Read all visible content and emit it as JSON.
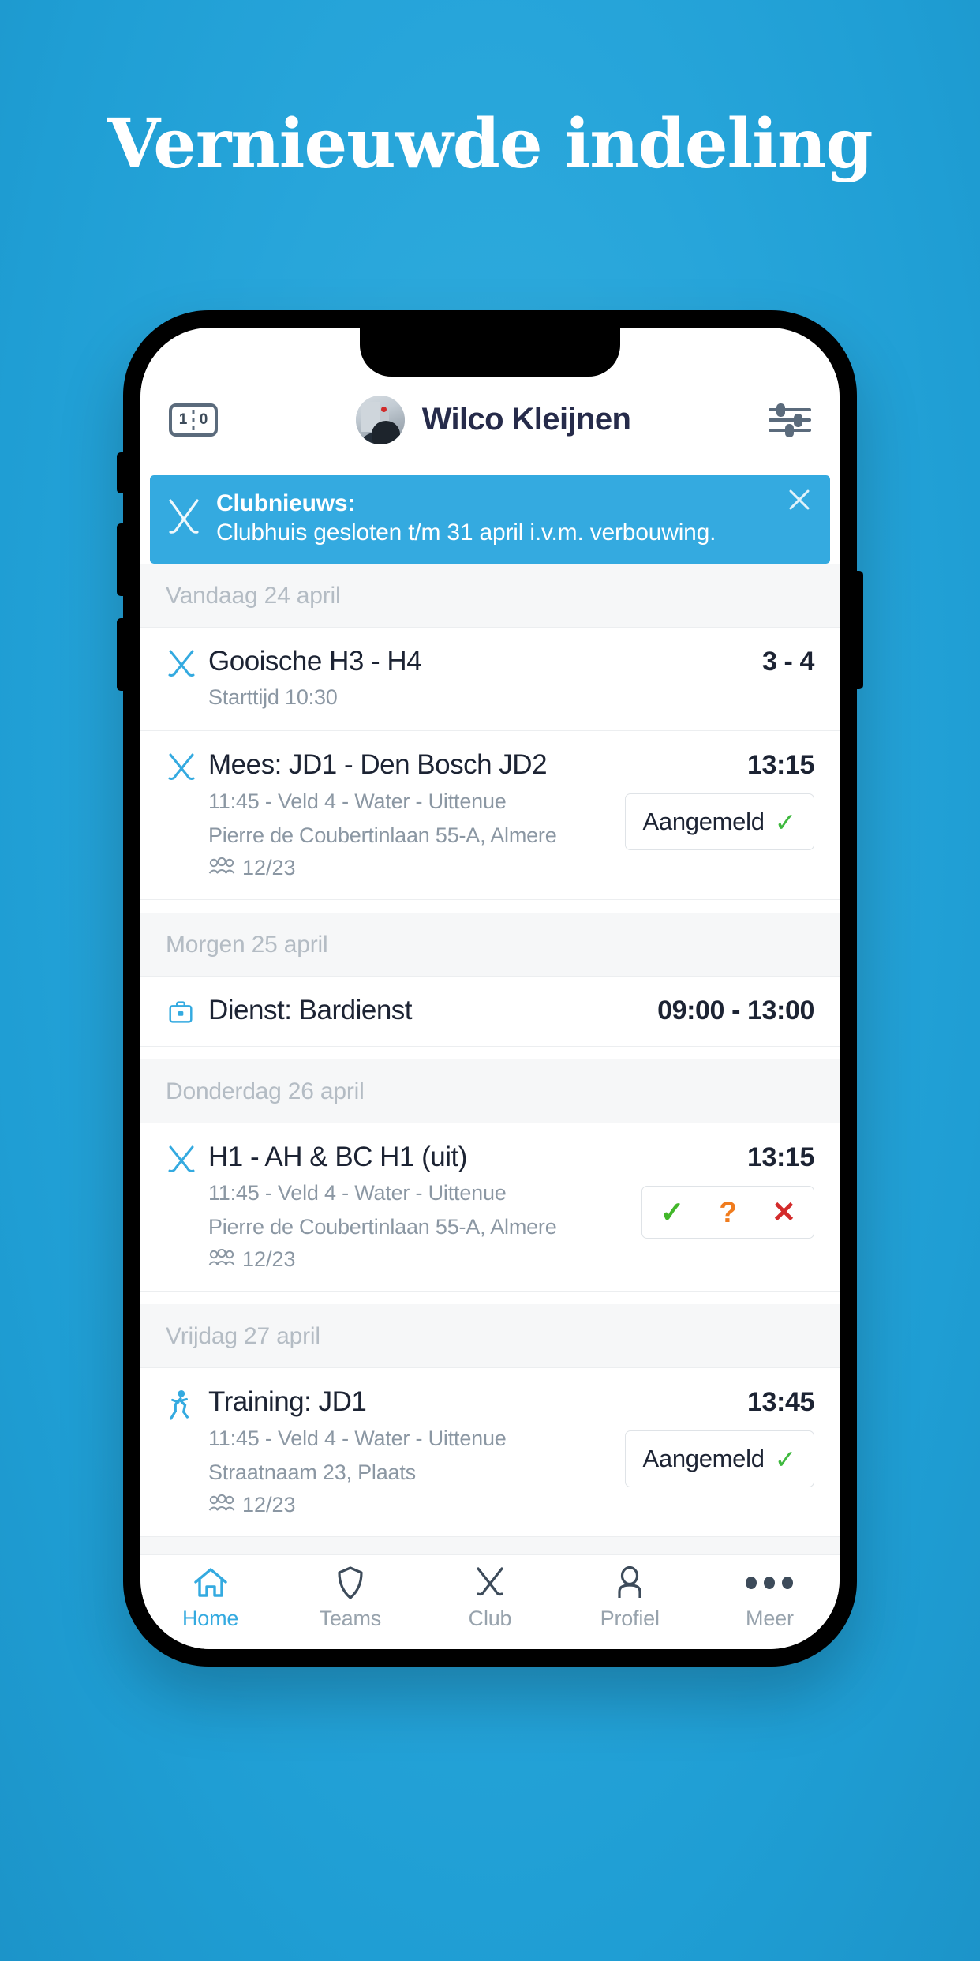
{
  "page": {
    "headline": "Vernieuwde indeling",
    "background_color": "#27a5da"
  },
  "app": {
    "header": {
      "scoreboard_icon": {
        "home": "1",
        "away": "0"
      },
      "user_name": "Wilco Kleijnen",
      "settings_icon": "sliders-icon"
    },
    "banner": {
      "icon": "crossed-hockey-sticks-icon",
      "title": "Clubnieuws:",
      "body": "Clubhuis gesloten t/m 31 april i.v.m. verbouwing.",
      "close_label": "×",
      "color": "#34aae0"
    },
    "sections": [
      {
        "day_label": "Vandaag 24 april",
        "events": [
          {
            "icon": "hockey-sticks-icon",
            "title": "Gooische H3 - H4",
            "sub1": "Starttijd 10:30",
            "sub2": null,
            "people": null,
            "time": "3 - 4",
            "action": null
          },
          {
            "icon": "hockey-sticks-icon",
            "title": "Mees: JD1 - Den Bosch JD2",
            "sub1": "11:45 - Veld 4 - Water - Uittenue",
            "sub2": "Pierre de Coubertinlaan 55-A, Almere",
            "people": "12/23",
            "time": "13:15",
            "action": {
              "type": "status",
              "label": "Aangemeld",
              "check": "✓"
            }
          }
        ]
      },
      {
        "day_label": "Morgen 25 april",
        "events": [
          {
            "icon": "briefcase-icon",
            "title": "Dienst: Bardienst",
            "sub1": null,
            "sub2": null,
            "people": null,
            "time": "09:00 - 13:00",
            "action": null
          }
        ]
      },
      {
        "day_label": "Donderdag 26 april",
        "events": [
          {
            "icon": "hockey-sticks-icon",
            "title": "H1 - AH & BC H1 (uit)",
            "sub1": "11:45 - Veld 4 - Water - Uittenue",
            "sub2": "Pierre de Coubertinlaan 55-A, Almere",
            "people": "12/23",
            "time": "13:15",
            "action": {
              "type": "choices",
              "yes": "✓",
              "maybe": "?",
              "no": "✕",
              "yes_color": "#42b72a",
              "maybe_color": "#f07c1e",
              "no_color": "#d32b2b"
            }
          }
        ]
      },
      {
        "day_label": "Vrijdag 27 april",
        "events": [
          {
            "icon": "running-person-icon",
            "title": "Training: JD1",
            "sub1": "11:45 - Veld 4 - Water - Uittenue",
            "sub2": "Straatnaam 23, Plaats",
            "people": "12/23",
            "time": "13:45",
            "action": {
              "type": "status",
              "label": "Aangemeld",
              "check": "✓"
            }
          }
        ]
      }
    ],
    "bottom_nav": {
      "active_color": "#34aae0",
      "items": [
        {
          "label": "Home",
          "icon": "home-icon",
          "active": true
        },
        {
          "label": "Teams",
          "icon": "shield-icon",
          "active": false
        },
        {
          "label": "Club",
          "icon": "crossed-sticks-icon",
          "active": false
        },
        {
          "label": "Profiel",
          "icon": "person-icon",
          "active": false
        },
        {
          "label": "Meer",
          "icon": "more-dots-icon",
          "active": false
        }
      ]
    }
  }
}
